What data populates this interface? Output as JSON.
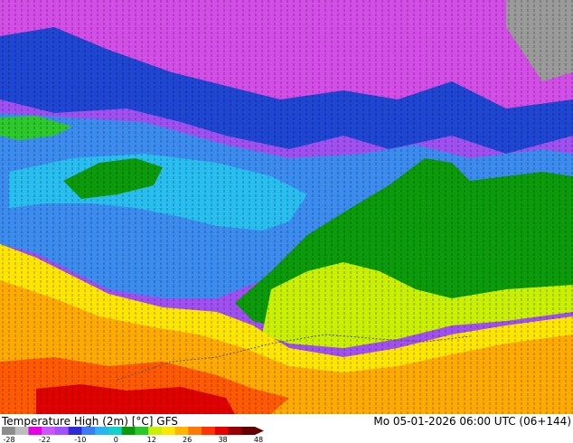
{
  "map": {
    "title": "Temperature High (2m) [°C] GFS",
    "datetime": "Mo 05-01-2026 06:00 UTC (06+144)"
  },
  "legend": {
    "ticks": [
      "-28",
      "-22",
      "-10",
      "0",
      "12",
      "26",
      "38",
      "48"
    ],
    "colors": [
      "#8c8c8c",
      "#bdbdbd",
      "#e600e6",
      "#cc55ff",
      "#a050ff",
      "#2a2ad6",
      "#3a7cf5",
      "#28b4f0",
      "#10d2c8",
      "#0a9a0a",
      "#28c828",
      "#c8f000",
      "#ffe600",
      "#ffb400",
      "#ff7800",
      "#ff3200",
      "#e60000",
      "#9b0000",
      "#640000"
    ]
  },
  "scale": {
    "white": "#e8e8e8",
    "gray": "#9a9a9a",
    "magenta": "#d24ee6",
    "purple": "#a050f0",
    "blue": "#1e46d2",
    "mid_blue": "#3c8cf0",
    "light_blue": "#28bef0",
    "cyan": "#14dcc8",
    "green": "#0a9a0a",
    "light_green": "#2cc82c",
    "yellow_green": "#c8f000",
    "yellow": "#ffe600",
    "orange": "#ffaa00",
    "red_orange": "#ff5a00",
    "red": "#e10000"
  }
}
